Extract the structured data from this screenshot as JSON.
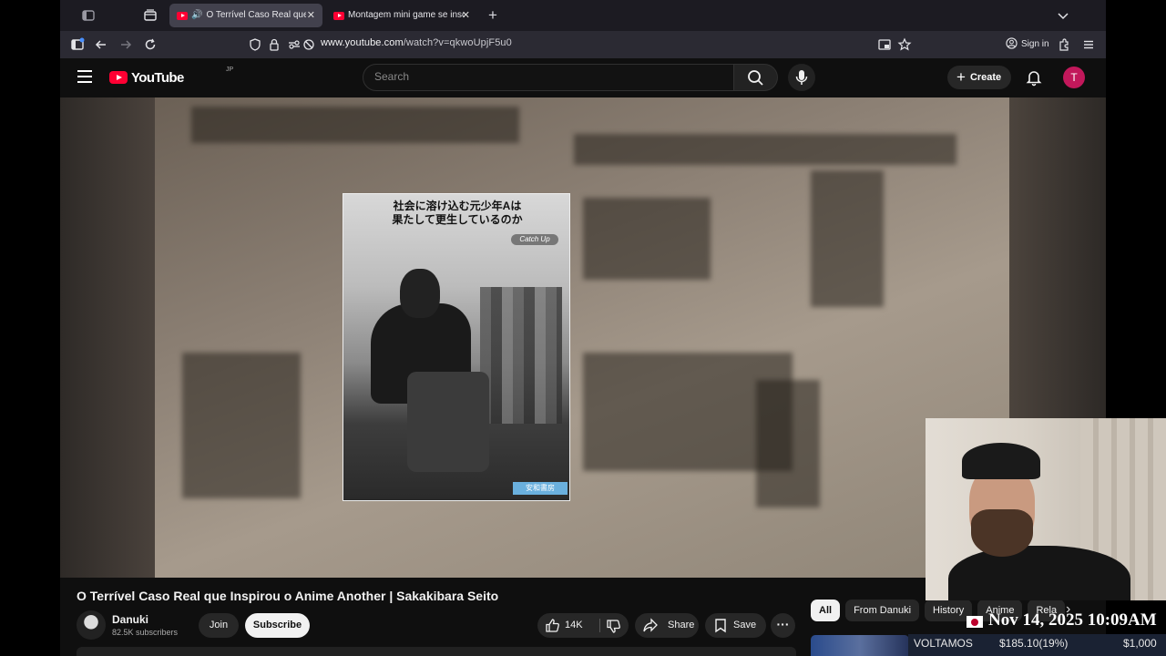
{
  "browser": {
    "tabs": [
      {
        "title": "O Terrível Caso Real que Ins",
        "active": true,
        "audio": true
      },
      {
        "title": "Montagem mini game se inscre",
        "active": false,
        "audio": false
      }
    ],
    "url_host": "www.youtube.com",
    "url_path": "/watch?v=qkwoUpjF5u0",
    "sign_in": "Sign in"
  },
  "youtube": {
    "logo_text": "YouTube",
    "region": "JP",
    "search_placeholder": "Search",
    "create_label": "Create",
    "avatar_letter": "T"
  },
  "video_frame": {
    "caption_line1": "社会に溶け込む元少年Aは",
    "caption_line2": "果たして更生しているのか",
    "badge": "Catch Up",
    "stamp": "安和書房"
  },
  "video": {
    "title": "O Terrível Caso Real que Inspirou o Anime Another | Sakakibara Seito",
    "channel": "Danuki",
    "subscribers": "82.5K subscribers",
    "join_label": "Join",
    "subscribe_label": "Subscribe",
    "likes": "14K",
    "share_label": "Share",
    "save_label": "Save"
  },
  "chips": [
    "All",
    "From Danuki",
    "History",
    "Anime",
    "Rela"
  ],
  "overlay": {
    "datetime": "Nov 14, 2025 10:09AM",
    "ticker_label": "VOLTAMOS",
    "ticker_value": "$185.10(19%)",
    "ticker_goal": "$1,000"
  },
  "colors": {
    "youtube_red": "#ff0033",
    "browser_tab_bg": "#1c1b22",
    "browser_nav_bg": "#2b2a33",
    "yt_bg": "#0f0f0f",
    "avatar_bg": "#c2185b"
  }
}
